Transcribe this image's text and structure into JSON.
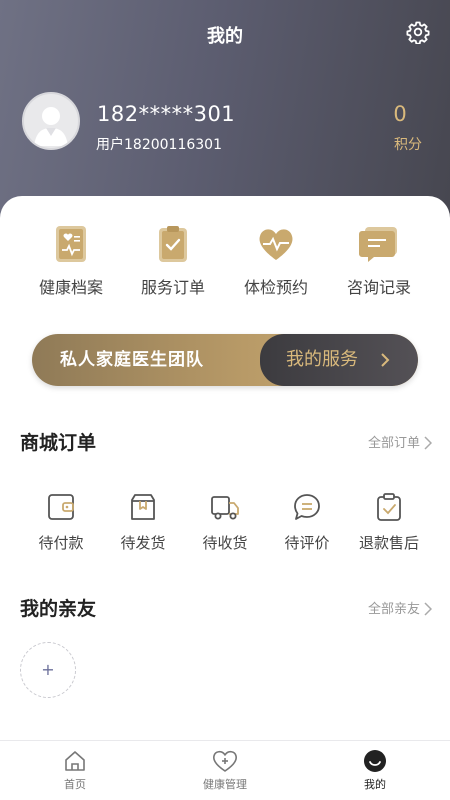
{
  "header": {
    "title": "我的",
    "settings_icon": "gear-icon"
  },
  "profile": {
    "username": "182*****301",
    "user_id": "用户18200116301",
    "points_value": "0",
    "points_label": "积分"
  },
  "quick_actions": [
    {
      "label": "健康档案",
      "icon": "health-record-icon"
    },
    {
      "label": "服务订单",
      "icon": "clipboard-check-icon"
    },
    {
      "label": "体检预约",
      "icon": "heartbeat-icon"
    },
    {
      "label": "咨询记录",
      "icon": "chat-record-icon"
    }
  ],
  "banner": {
    "left_text": "私人家庭医生团队",
    "right_text": "我的服务"
  },
  "mall_orders": {
    "title": "商城订单",
    "more": "全部订单",
    "items": [
      {
        "label": "待付款",
        "icon": "wallet-icon"
      },
      {
        "label": "待发货",
        "icon": "box-icon"
      },
      {
        "label": "待收货",
        "icon": "truck-icon"
      },
      {
        "label": "待评价",
        "icon": "comment-icon"
      },
      {
        "label": "退款售后",
        "icon": "clipboard-check-icon"
      }
    ]
  },
  "friends": {
    "title": "我的亲友",
    "more": "全部亲友",
    "add_label": "+"
  },
  "tabbar": [
    {
      "label": "首页",
      "icon": "home-icon",
      "active": false
    },
    {
      "label": "健康管理",
      "icon": "heart-plus-icon",
      "active": false
    },
    {
      "label": "我的",
      "icon": "smile-icon",
      "active": true
    }
  ],
  "colors": {
    "gold": "#c9a96e",
    "gold_text": "#d9b97c",
    "header_dark": "#46464f",
    "header_light": "#6f7184",
    "tab_active": "#222222"
  }
}
